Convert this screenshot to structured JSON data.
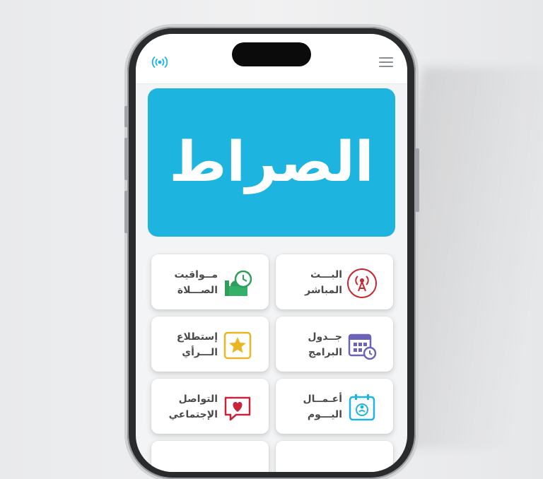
{
  "app": {
    "logo_text": "الصراط"
  },
  "topbar": {
    "live_icon": "broadcast-icon",
    "menu_icon": "hamburger-menu-icon"
  },
  "tiles": [
    {
      "line1": "البـــث",
      "line2": "المباشر",
      "icon": "broadcast-tower-icon"
    },
    {
      "line1": "مــواقيت",
      "line2": "الصـــلاة",
      "icon": "mosque-clock-icon"
    },
    {
      "line1": "جــدول",
      "line2": "البرامج",
      "icon": "calendar-clock-icon"
    },
    {
      "line1": "إستطلاع",
      "line2": "الـــرأي",
      "icon": "star-icon"
    },
    {
      "line1": "أعـمــال",
      "line2": "اليـــوم",
      "icon": "prayer-calendar-icon"
    },
    {
      "line1": "التواصل",
      "line2": "الإجتماعي",
      "icon": "heart-message-icon"
    }
  ],
  "colors": {
    "accent": "#1eb4e0",
    "broadcast_red": "#c8252c",
    "calendar_purple": "#6a63b8",
    "star_gold": "#e9b521",
    "heart_red": "#c8233a",
    "mosque_green": "#2e9e5a"
  }
}
